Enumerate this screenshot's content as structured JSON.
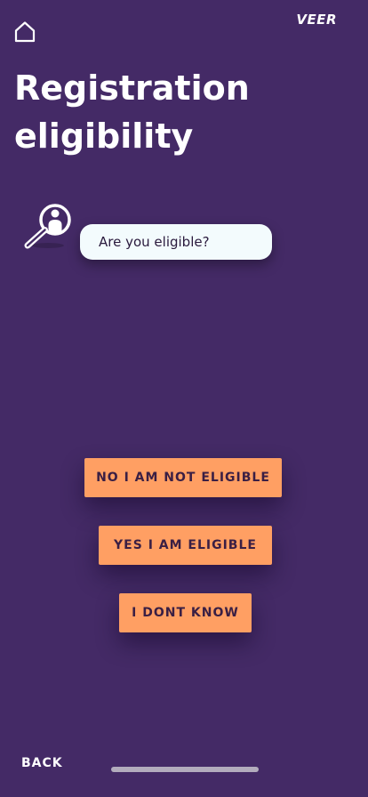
{
  "header": {
    "brand": "VEER"
  },
  "page": {
    "title_line1": "Registration",
    "title_line2": "eligibility"
  },
  "prompt": {
    "question": "Are you eligible?"
  },
  "options": [
    {
      "label": "NO I AM NOT ELIGIBLE"
    },
    {
      "label": "YES I AM ELIGIBLE"
    },
    {
      "label": "I DONT KNOW"
    }
  ],
  "footer": {
    "back_label": "BACK"
  },
  "icons": {
    "home": "home-icon",
    "search_person": "search-person-icon"
  },
  "colors": {
    "background": "#442a66",
    "button": "#ff9f63",
    "button_text": "#3a1f44",
    "bubble": "#f3fbfd"
  }
}
